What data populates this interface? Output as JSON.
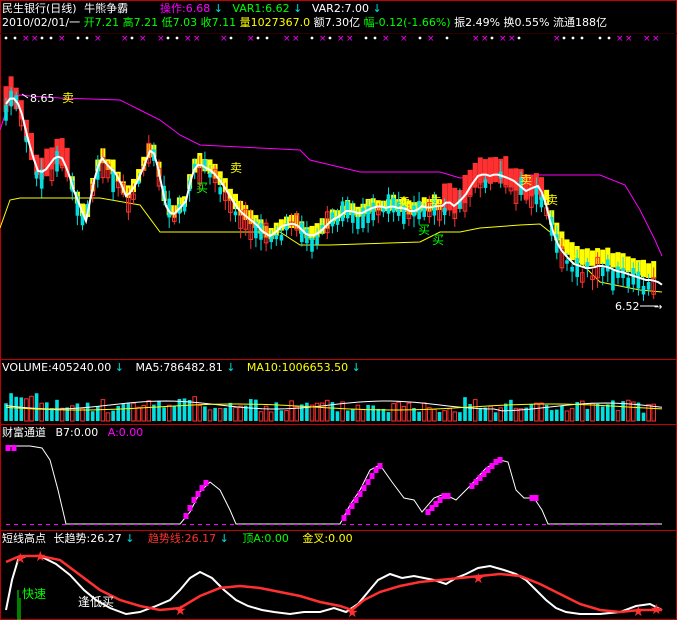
{
  "header": {
    "stock": "民生银行(日线)",
    "indicator": "牛熊争霸",
    "op_label": "操作:6.68",
    "var1_label": "VAR1:6.62",
    "var2_label": "VAR2:7.00",
    "arrow": "↓",
    "date": "2010/02/01/一",
    "open": "开7.21",
    "high": "高7.21",
    "low": "低7.03",
    "close": "收7.11",
    "volume": "量1027367.0",
    "amount": "额7.30亿",
    "change": "幅-0.12(-1.66%)",
    "amplitude": "振2.49%",
    "turnover": "换0.55%",
    "float": "流通188亿"
  },
  "main_panel": {
    "high_mark": "8.65",
    "low_mark": "6.52",
    "buy": "买",
    "sell": "卖"
  },
  "volume_panel": {
    "volume": "VOLUME:405240.00",
    "ma5": "MA5:786482.81",
    "ma10": "MA10:1006653.50"
  },
  "wealth_panel": {
    "title": "财富通道",
    "b7": "B7:0.00",
    "a": "A:0.00"
  },
  "short_panel": {
    "title": "短线高点",
    "long": "长趋势:26.27",
    "trend": "趋势线:26.17",
    "top": "顶A:0.00",
    "golden": "金叉:0.00",
    "fast": "快速",
    "buy_low": "逢低买"
  },
  "colors": {
    "background": "#000000",
    "divider": "#c00000",
    "up": "#ff3030",
    "down": "#00e0e0",
    "yellow": "#ffff00",
    "magenta": "#ff00ff",
    "white": "#ffffff",
    "green": "#00ff00"
  },
  "chart_data": [
    {
      "type": "candlestick",
      "markers": {
        "high": 8.65,
        "low": 6.52
      },
      "signals": [
        "卖",
        "买",
        "卖",
        "卖",
        "卖",
        "买",
        "买",
        "卖",
        "卖"
      ]
    },
    {
      "type": "bar",
      "series": [
        {
          "name": "VOLUME",
          "last": 405240.0
        },
        {
          "name": "MA5",
          "last": 786482.81
        },
        {
          "name": "MA10",
          "last": 1006653.5
        }
      ]
    },
    {
      "type": "line",
      "series": [
        {
          "name": "B7",
          "last": 0.0
        },
        {
          "name": "A",
          "last": 0.0
        }
      ]
    },
    {
      "type": "line",
      "series": [
        {
          "name": "长趋势",
          "last": 26.27
        },
        {
          "name": "趋势线",
          "last": 26.17
        },
        {
          "name": "顶A",
          "last": 0.0
        },
        {
          "name": "金叉",
          "last": 0.0
        }
      ]
    }
  ]
}
